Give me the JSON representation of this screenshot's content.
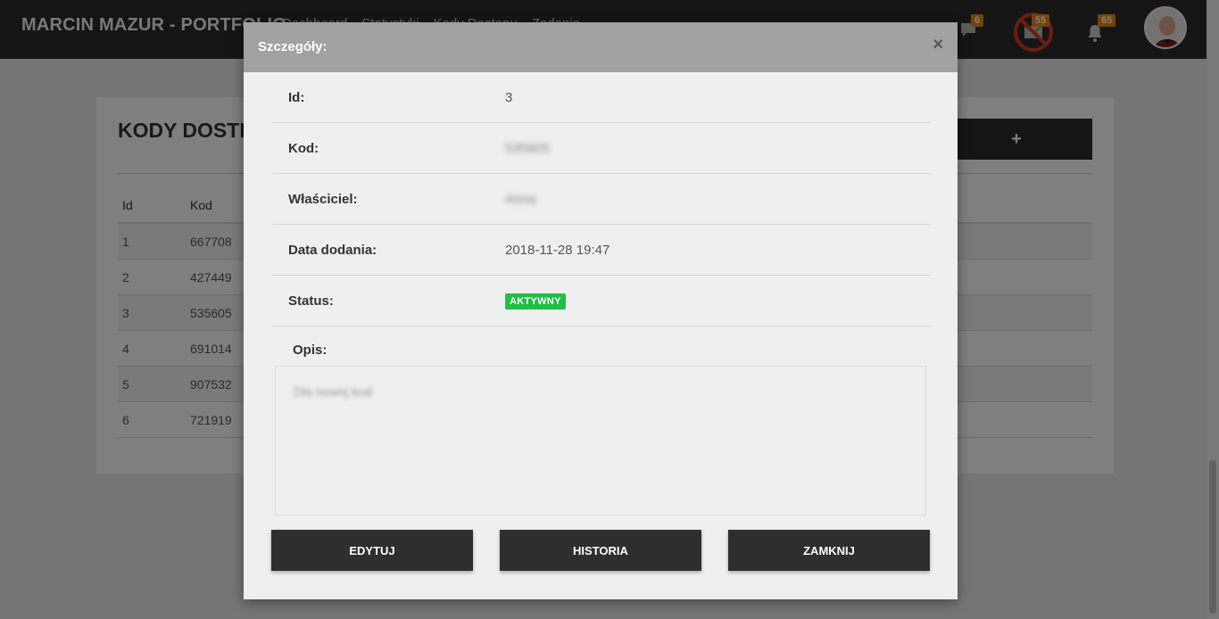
{
  "app": {
    "brand": "MARCIN MAZUR - PORTFOLIO",
    "nav": [
      "Dashboard",
      "Statystyki",
      "Kody Dostępu",
      "Zadania"
    ],
    "badges": {
      "messages": "6",
      "mail": "55",
      "notifications": "65"
    }
  },
  "page": {
    "title": "KODY DOSTĘPU",
    "add_label": "+",
    "table": {
      "headers": {
        "id": "Id",
        "kod": "Kod"
      },
      "rows": [
        {
          "id": "1",
          "kod": "667708"
        },
        {
          "id": "2",
          "kod": "427449"
        },
        {
          "id": "3",
          "kod": "535605"
        },
        {
          "id": "4",
          "kod": "691014"
        },
        {
          "id": "5",
          "kod": "907532"
        },
        {
          "id": "6",
          "kod": "721919"
        }
      ]
    }
  },
  "modal": {
    "title": "Szczegóły:",
    "close_glyph": "×",
    "fields": {
      "id": {
        "label": "Id:",
        "value": "3"
      },
      "kod": {
        "label": "Kod:",
        "value": "535605"
      },
      "owner": {
        "label": "Właściciel:",
        "value": "Anna"
      },
      "date": {
        "label": "Data dodania:",
        "value": "2018-11-28 19:47"
      },
      "status": {
        "label": "Status:",
        "value": "AKTYWNY"
      }
    },
    "description": {
      "label": "Opis:",
      "value": "Dla nowej kod"
    },
    "buttons": {
      "edit": "EDYTUJ",
      "history": "HISTORIA",
      "close": "ZAMKNIJ"
    }
  },
  "colors": {
    "status_active": "#1fbf45",
    "badge": "#e8890f",
    "dark": "#2b2b2b"
  }
}
